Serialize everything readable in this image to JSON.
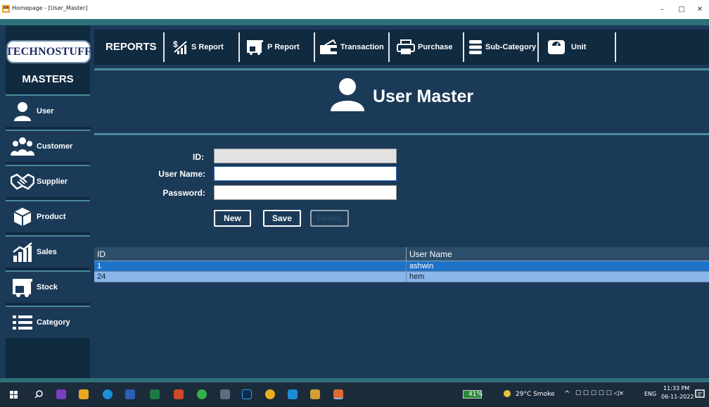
{
  "window": {
    "title": "Homepage - [User_Master]",
    "minimize": "–",
    "maximize": "□",
    "close": "✕"
  },
  "brand": {
    "logo_text": "TECHNOSTUFF"
  },
  "toolbar": {
    "reports_label": "REPORTS",
    "buttons": [
      {
        "label": "S Report",
        "icon": "sales-report-icon"
      },
      {
        "label": "P Report",
        "icon": "purchase-report-icon"
      },
      {
        "label": "Transaction",
        "icon": "wallet-icon"
      },
      {
        "label": "Purchase",
        "icon": "printer-icon"
      },
      {
        "label": "Sub-Category",
        "icon": "list-icon"
      },
      {
        "label": "Unit",
        "icon": "scale-icon"
      }
    ]
  },
  "sidebar": {
    "title": "MASTERS",
    "items": [
      {
        "label": "User",
        "icon": "user-icon"
      },
      {
        "label": "Customer",
        "icon": "customers-icon"
      },
      {
        "label": "Supplier",
        "icon": "handshake-icon"
      },
      {
        "label": "Product",
        "icon": "product-icon"
      },
      {
        "label": "Sales",
        "icon": "chart-icon"
      },
      {
        "label": "Stock",
        "icon": "truck-icon"
      },
      {
        "label": "Category",
        "icon": "list-icon"
      }
    ]
  },
  "form": {
    "title": "User Master",
    "fields": {
      "id": {
        "label": "ID:",
        "value": ""
      },
      "username": {
        "label": "User Name:",
        "value": ""
      },
      "password": {
        "label": "Password:",
        "value": ""
      }
    },
    "buttons": {
      "new": "New",
      "save": "Save",
      "delete": "Delete"
    }
  },
  "grid": {
    "columns": [
      "ID",
      "User Name"
    ],
    "rows": [
      {
        "id": "1",
        "username": "ashwin",
        "selected": true
      },
      {
        "id": "24",
        "username": "hem",
        "selected": false
      }
    ]
  },
  "taskbar": {
    "battery": "41%",
    "weather": "29°C Smoke",
    "lang": "ENG",
    "time": "11:33 PM",
    "date": "06-11-2022"
  },
  "colors": {
    "app_bg": "#1b3a57",
    "panel_dark": "#102a40",
    "accent_line": "#4a8aa0",
    "row_selected": "#1e73c8",
    "row_alt": "#8ab6ea"
  }
}
